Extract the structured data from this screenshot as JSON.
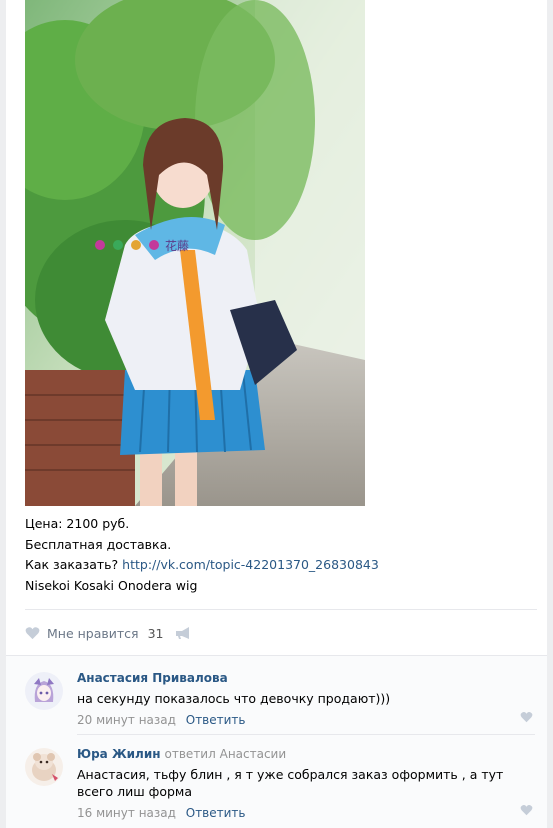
{
  "post": {
    "photo_alt": "cosplay",
    "watermark": "花藤",
    "lines": {
      "price": "Цена: 2100 руб.",
      "delivery": "Бесплатная доставка.",
      "order_prefix": "Как заказать?",
      "order_link": "http://vk.com/topic-42201370_26830843",
      "product": "Nisekoi Kosaki Onodera wig"
    },
    "likes": {
      "label": "Мне нравится",
      "count": "31"
    }
  },
  "comments": [
    {
      "author": "Анастасия Привалова",
      "replied_label": "",
      "reply_to": "",
      "text": "на секунду показалось что девочку продают)))",
      "time": "20 минут назад",
      "reply_button": "Ответить"
    },
    {
      "author": "Юра Жилин",
      "replied_label": "ответил",
      "reply_to": "Анастасии",
      "text": "Анастасия, тьфу блин , я т уже собрался заказ оформить , а тут всего лиш форма",
      "time": "16 минут назад",
      "reply_button": "Ответить"
    }
  ],
  "colors": {
    "link": "#2a5885",
    "muted": "#939393",
    "divider": "#e7e8ec"
  }
}
